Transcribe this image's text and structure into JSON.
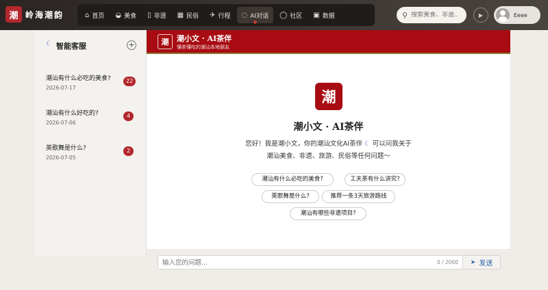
{
  "brand": {
    "logo_char": "潮",
    "name": "岭海潮韵"
  },
  "nav": [
    {
      "icon": "⌂",
      "label": "首页"
    },
    {
      "icon": "◒",
      "label": "美食"
    },
    {
      "icon": "▯",
      "label": "非遗"
    },
    {
      "icon": "▦",
      "label": "民俗"
    },
    {
      "icon": "✈",
      "label": "行程"
    },
    {
      "icon": "◌",
      "label": "AI对话",
      "active": true
    },
    {
      "icon": "◯",
      "label": "社区"
    },
    {
      "icon": "▣",
      "label": "数据"
    }
  ],
  "search": {
    "icon": "⚲",
    "placeholder": "搜索美食、非遗..."
  },
  "user": {
    "name": "Eeee"
  },
  "sidebar": {
    "title": "智能客服",
    "new_chat_label": "+",
    "conversations": [
      {
        "question": "潮汕有什么必吃的美食?",
        "date": "2026-07-17",
        "count": "22"
      },
      {
        "question": "潮汕有什么好吃的?",
        "date": "2026-07-06",
        "count": "4"
      },
      {
        "question": "英歌舞是什么?",
        "date": "2026-07-05",
        "count": "2"
      }
    ]
  },
  "chat_header": {
    "logo_char": "潮",
    "name": "潮小文 · AI茶伴",
    "subtitle": "懂茶懂吃的潮汕本地朋友"
  },
  "welcome": {
    "logo_char": "潮",
    "title": "潮小文 · AI茶伴",
    "line1_before": "您好！我是潮小文，你的潮汕文化AI茶伴",
    "line1_after": "可以问我关于",
    "line2": "潮汕美食、非遗、旅游、民俗等任何问题～"
  },
  "suggestions": [
    "潮汕有什么必吃的美食?",
    "工夫茶有什么讲究?",
    "英歌舞是什么?",
    "推荐一条3天旅游路线",
    "潮汕有哪些非遗项目?"
  ],
  "input": {
    "placeholder": "输入您的问题...",
    "counter": "0 / 2000",
    "send_label": "发送"
  },
  "colors": {
    "brand_red": "#a80c12",
    "badge_red": "#b3282d",
    "header_dark": "#2a2522",
    "send_blue": "#2b63a8"
  }
}
